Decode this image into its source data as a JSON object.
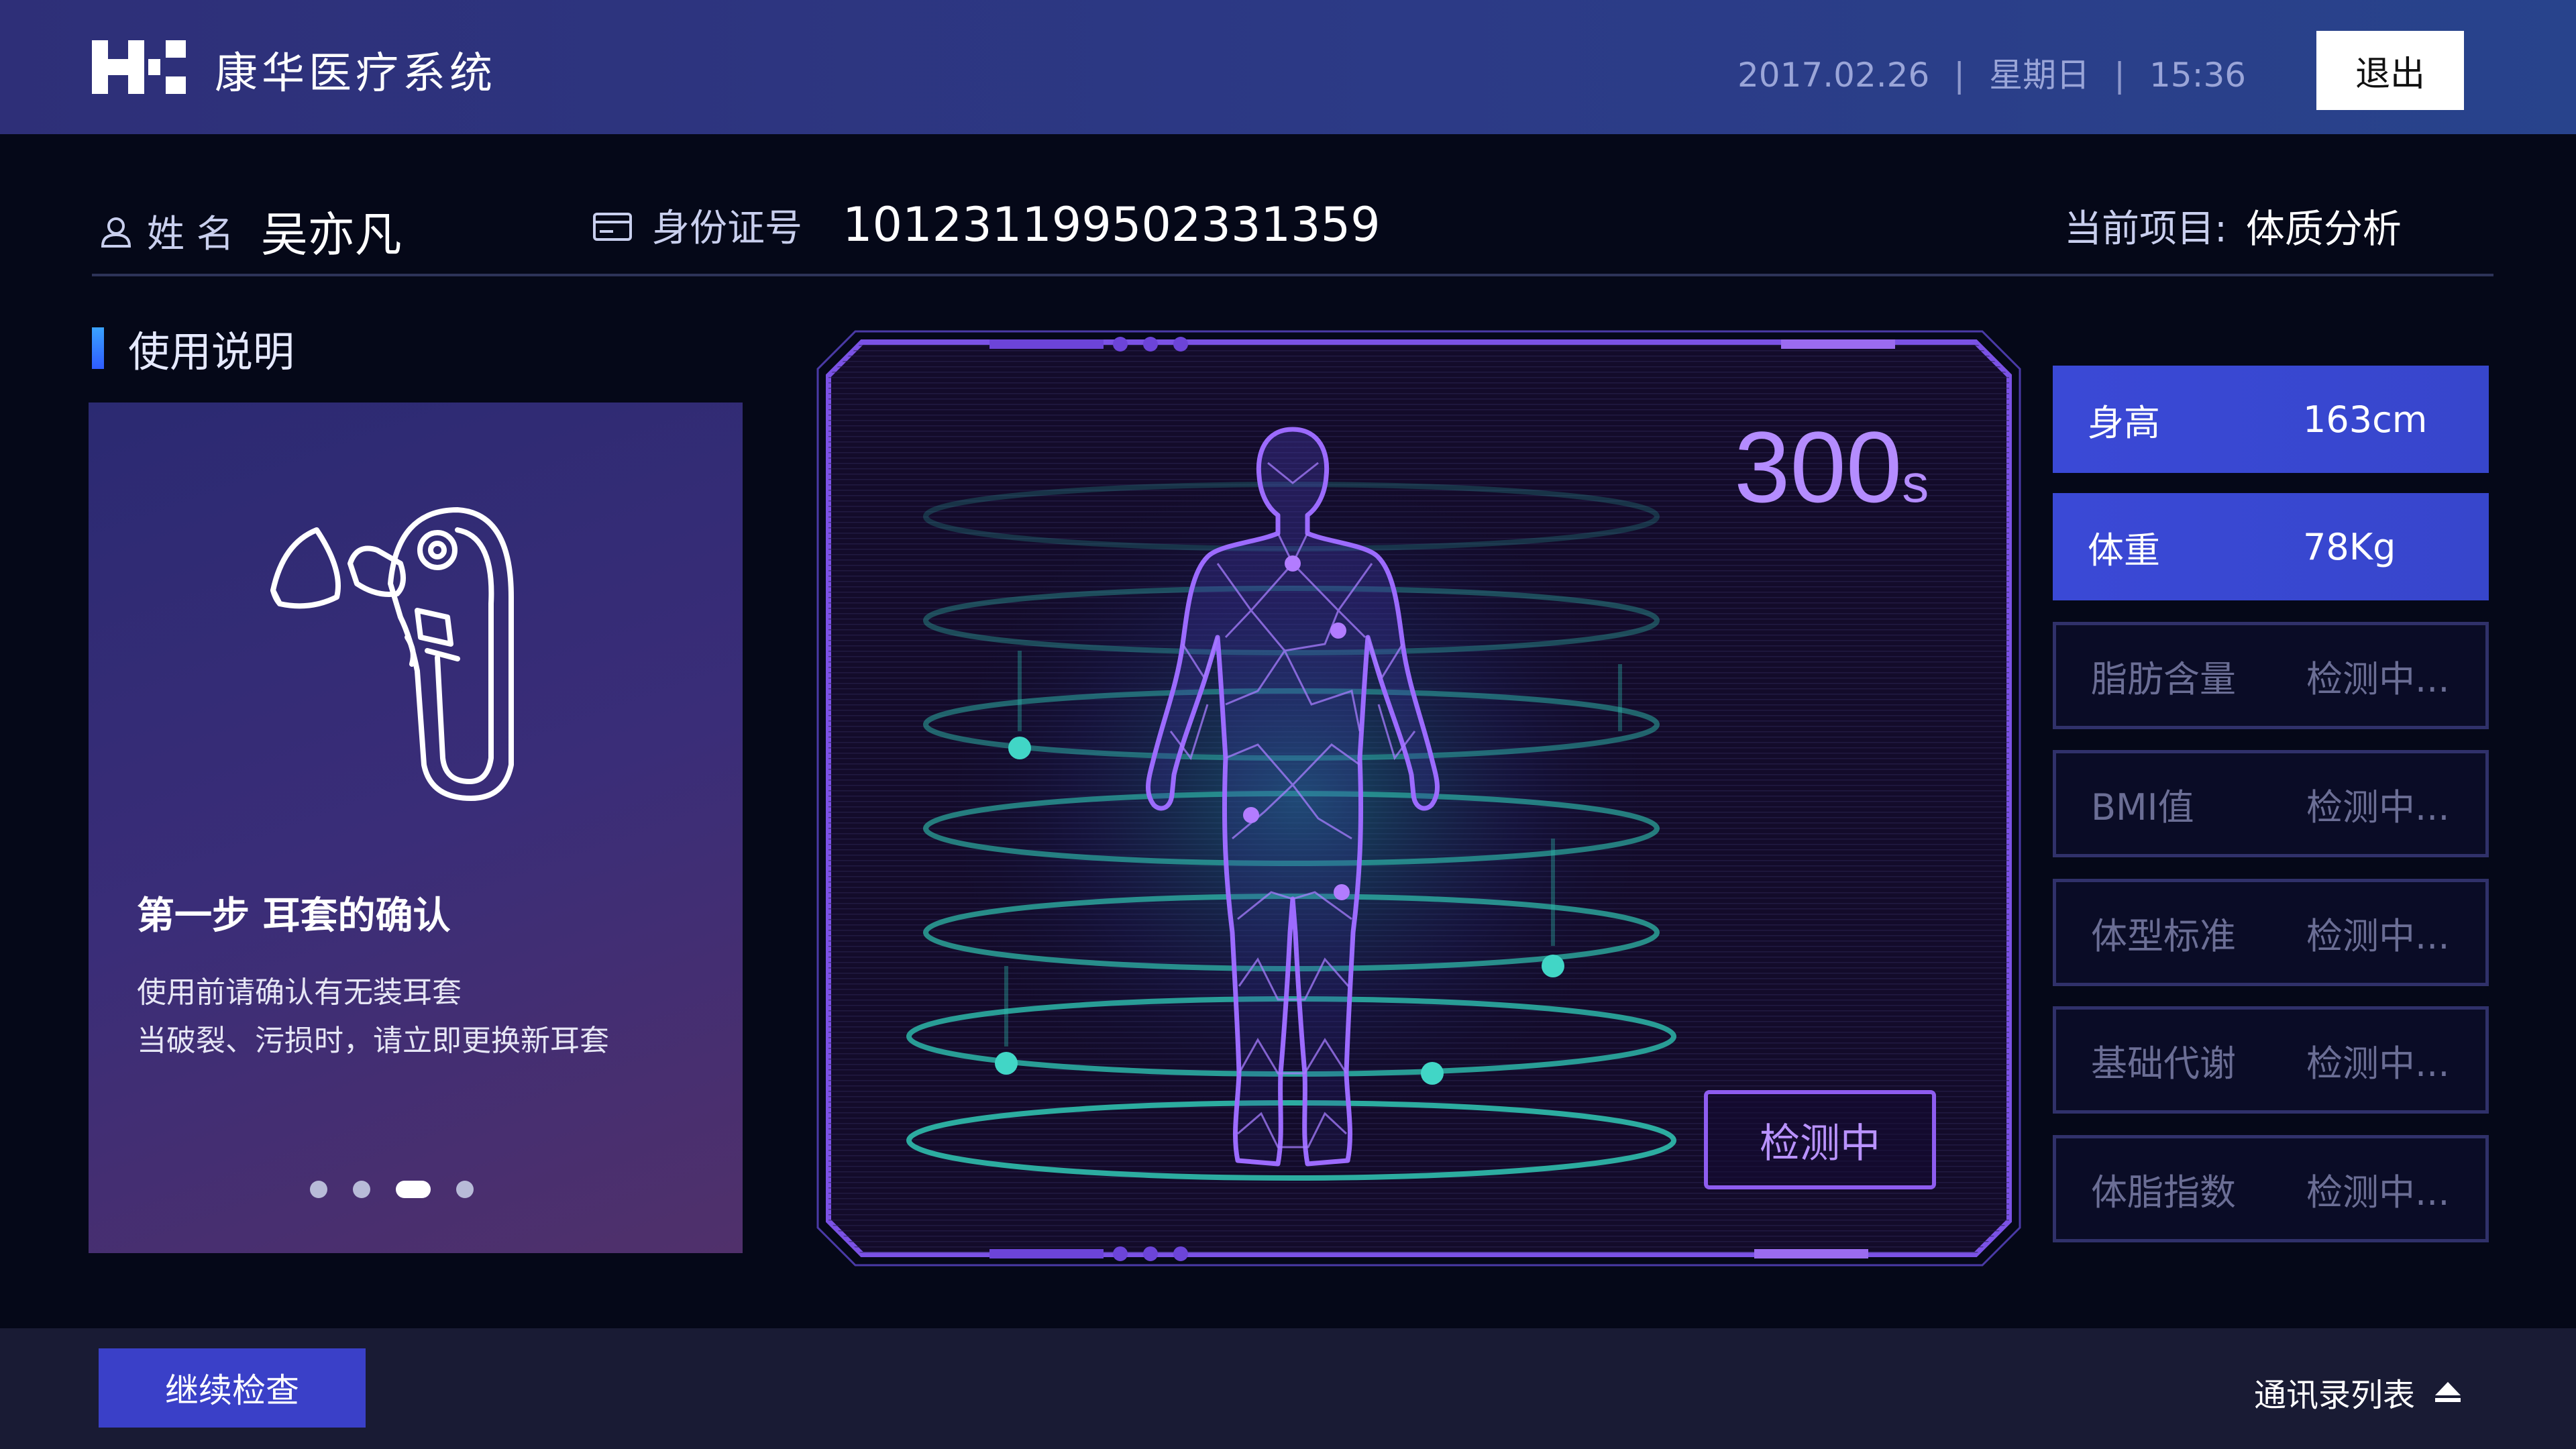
{
  "header": {
    "app_title": "康华医疗系统",
    "date": "2017.02.26",
    "weekday": "星期日",
    "time": "15:36",
    "logout_label": "退出"
  },
  "patient": {
    "name_label": "姓 名",
    "name": "吴亦凡",
    "id_label": "身份证号",
    "id_number": "101231199502331359",
    "project_label": "当前项目:",
    "project": "体质分析"
  },
  "guide": {
    "section_title": "使用说明",
    "step_title": "第一步  耳套的确认",
    "desc_line1": "使用前请确认有无装耳套",
    "desc_line2": "当破裂、污损时，请立即更换新耳套",
    "page_count": 4,
    "active_page": 3
  },
  "scan": {
    "countdown": "300",
    "countdown_unit": "s",
    "status_button": "检测中",
    "colors": {
      "accent": "#8e5df0",
      "ring": "#2fbfae"
    }
  },
  "metrics": [
    {
      "label": "身高",
      "value": "163cm",
      "state": "done"
    },
    {
      "label": "体重",
      "value": "78Kg",
      "state": "done"
    },
    {
      "label": "脂肪含量",
      "value": "检测中...",
      "state": "pending"
    },
    {
      "label": "BMI值",
      "value": "检测中...",
      "state": "pending"
    },
    {
      "label": "体型标准",
      "value": "检测中...",
      "state": "pending"
    },
    {
      "label": "基础代谢",
      "value": "检测中...",
      "state": "pending"
    },
    {
      "label": "体脂指数",
      "value": "检测中...",
      "state": "pending"
    }
  ],
  "footer": {
    "continue_label": "继续检查",
    "contacts_label": "通讯录列表"
  },
  "icons": {
    "logo": "brand-logo",
    "user": "user-icon",
    "id_card": "id-card-icon",
    "contacts_toggle": "eject-triangle-icon"
  }
}
